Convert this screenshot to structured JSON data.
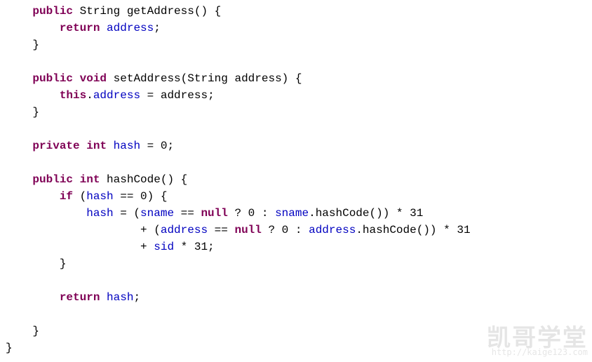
{
  "lines": [
    [
      {
        "cls": "plain",
        "t": "    "
      },
      {
        "cls": "kw",
        "t": "public"
      },
      {
        "cls": "plain",
        "t": " String getAddress() {"
      }
    ],
    [
      {
        "cls": "plain",
        "t": "        "
      },
      {
        "cls": "kw",
        "t": "return"
      },
      {
        "cls": "plain",
        "t": " "
      },
      {
        "cls": "fld",
        "t": "address"
      },
      {
        "cls": "plain",
        "t": ";"
      }
    ],
    [
      {
        "cls": "plain",
        "t": "    }"
      }
    ],
    [
      {
        "cls": "plain",
        "t": ""
      }
    ],
    [
      {
        "cls": "plain",
        "t": "    "
      },
      {
        "cls": "kw",
        "t": "public"
      },
      {
        "cls": "plain",
        "t": " "
      },
      {
        "cls": "kw",
        "t": "void"
      },
      {
        "cls": "plain",
        "t": " setAddress(String address) {"
      }
    ],
    [
      {
        "cls": "plain",
        "t": "        "
      },
      {
        "cls": "kw",
        "t": "this"
      },
      {
        "cls": "plain",
        "t": "."
      },
      {
        "cls": "fld",
        "t": "address"
      },
      {
        "cls": "plain",
        "t": " = address;"
      }
    ],
    [
      {
        "cls": "plain",
        "t": "    }"
      }
    ],
    [
      {
        "cls": "plain",
        "t": ""
      }
    ],
    [
      {
        "cls": "plain",
        "t": "    "
      },
      {
        "cls": "kw",
        "t": "private"
      },
      {
        "cls": "plain",
        "t": " "
      },
      {
        "cls": "kw",
        "t": "int"
      },
      {
        "cls": "plain",
        "t": " "
      },
      {
        "cls": "fld",
        "t": "hash"
      },
      {
        "cls": "plain",
        "t": " = 0;"
      }
    ],
    [
      {
        "cls": "plain",
        "t": ""
      }
    ],
    [
      {
        "cls": "plain",
        "t": "    "
      },
      {
        "cls": "kw",
        "t": "public"
      },
      {
        "cls": "plain",
        "t": " "
      },
      {
        "cls": "kw",
        "t": "int"
      },
      {
        "cls": "plain",
        "t": " hashCode() {"
      }
    ],
    [
      {
        "cls": "plain",
        "t": "        "
      },
      {
        "cls": "kw",
        "t": "if"
      },
      {
        "cls": "plain",
        "t": " ("
      },
      {
        "cls": "fld",
        "t": "hash"
      },
      {
        "cls": "plain",
        "t": " == 0) {"
      }
    ],
    [
      {
        "cls": "plain",
        "t": "            "
      },
      {
        "cls": "fld",
        "t": "hash"
      },
      {
        "cls": "plain",
        "t": " = ("
      },
      {
        "cls": "fld",
        "t": "sname"
      },
      {
        "cls": "plain",
        "t": " == "
      },
      {
        "cls": "kw",
        "t": "null"
      },
      {
        "cls": "plain",
        "t": " ? 0 : "
      },
      {
        "cls": "fld",
        "t": "sname"
      },
      {
        "cls": "plain",
        "t": ".hashCode()) * 31"
      }
    ],
    [
      {
        "cls": "plain",
        "t": "                    + ("
      },
      {
        "cls": "fld",
        "t": "address"
      },
      {
        "cls": "plain",
        "t": " == "
      },
      {
        "cls": "kw",
        "t": "null"
      },
      {
        "cls": "plain",
        "t": " ? 0 : "
      },
      {
        "cls": "fld",
        "t": "address"
      },
      {
        "cls": "plain",
        "t": ".hashCode()) * 31"
      }
    ],
    [
      {
        "cls": "plain",
        "t": "                    + "
      },
      {
        "cls": "fld",
        "t": "sid"
      },
      {
        "cls": "plain",
        "t": " * 31;"
      }
    ],
    [
      {
        "cls": "plain",
        "t": "        }"
      }
    ],
    [
      {
        "cls": "plain",
        "t": ""
      }
    ],
    [
      {
        "cls": "plain",
        "t": "        "
      },
      {
        "cls": "kw",
        "t": "return"
      },
      {
        "cls": "plain",
        "t": " "
      },
      {
        "cls": "fld",
        "t": "hash"
      },
      {
        "cls": "plain",
        "t": ";"
      }
    ],
    [
      {
        "cls": "plain",
        "t": ""
      }
    ],
    [
      {
        "cls": "plain",
        "t": "    }"
      }
    ],
    [
      {
        "cls": "plain",
        "t": "}"
      }
    ]
  ],
  "watermark": {
    "main": "凯哥学堂",
    "sub": "http://kaige123.com"
  }
}
